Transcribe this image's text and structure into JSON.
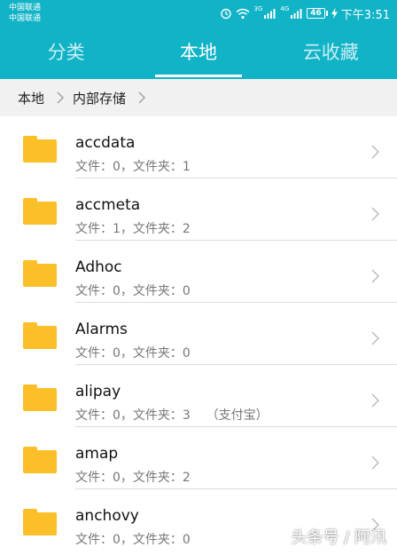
{
  "status_bar": {
    "carrier_1": "中国联通",
    "carrier_2": "中国联通",
    "net_1": "3G",
    "net_2": "4G",
    "battery": "46",
    "time": "下午3:51"
  },
  "tabs": [
    {
      "label": "分类",
      "active": false
    },
    {
      "label": "本地",
      "active": true
    },
    {
      "label": "云收藏",
      "active": false
    }
  ],
  "breadcrumb": [
    "本地",
    "内部存储"
  ],
  "files": [
    {
      "name": "accdata",
      "meta": "文件：0，文件夹：1"
    },
    {
      "name": "accmeta",
      "meta": "文件：1，文件夹：2"
    },
    {
      "name": "Adhoc",
      "meta": "文件：0，文件夹：0"
    },
    {
      "name": "Alarms",
      "meta": "文件：0，文件夹：0"
    },
    {
      "name": "alipay",
      "meta": "文件：0，文件夹：3    （支付宝）"
    },
    {
      "name": "amap",
      "meta": "文件：0，文件夹：2"
    },
    {
      "name": "anchovy",
      "meta": "文件：0，文件夹：0"
    }
  ],
  "watermark": "头条号 / 阿汛",
  "colors": {
    "header": "#11b3c6",
    "folder": "#fbbf27"
  },
  "icons": [
    "alarm-icon",
    "wifi-icon",
    "signal-icon",
    "battery-icon",
    "folder-icon",
    "chevron-right-icon"
  ]
}
